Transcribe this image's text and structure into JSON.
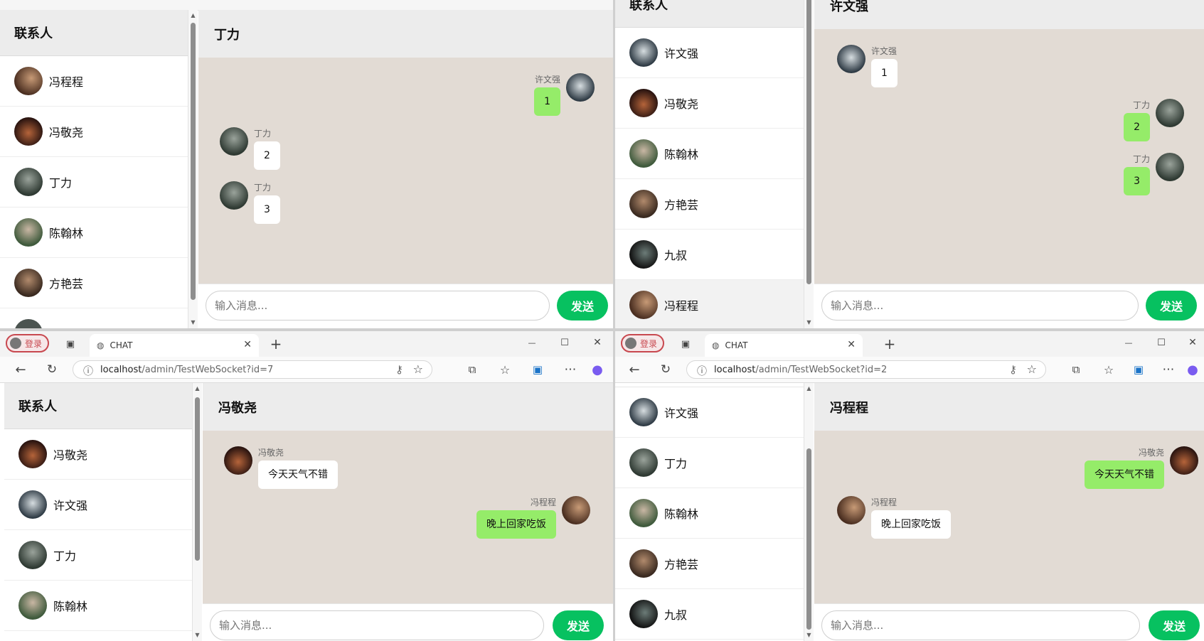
{
  "send_label": "发送",
  "input_placeholder": "输入消息...",
  "contacts_title": "联系人",
  "window_top_left": {
    "contacts": [
      "冯程程",
      "冯敬尧",
      "丁力",
      "陈翰林",
      "方艳芸"
    ],
    "chat_title": "丁力",
    "messages": [
      {
        "sender": "许文强",
        "text": "1",
        "side": "right"
      },
      {
        "sender": "丁力",
        "text": "2",
        "side": "left"
      },
      {
        "sender": "丁力",
        "text": "3",
        "side": "left"
      }
    ]
  },
  "window_top_right": {
    "contacts": [
      "许文强",
      "冯敬尧",
      "陈翰林",
      "方艳芸",
      "九叔",
      "冯程程"
    ],
    "chat_title": "许文强",
    "messages": [
      {
        "sender": "许文强",
        "text": "1",
        "side": "left"
      },
      {
        "sender": "丁力",
        "text": "2",
        "side": "right"
      },
      {
        "sender": "丁力",
        "text": "3",
        "side": "right"
      }
    ]
  },
  "window_bottom_left": {
    "tab_title": "CHAT",
    "profile_label": "登录",
    "url_host": "localhost",
    "url_path": "/admin/TestWebSocket?id=7",
    "contacts": [
      "冯敬尧",
      "许文强",
      "丁力",
      "陈翰林"
    ],
    "chat_title": "冯敬尧",
    "messages": [
      {
        "sender": "冯敬尧",
        "text": "今天天气不错",
        "side": "left"
      },
      {
        "sender": "冯程程",
        "text": "晚上回家吃饭",
        "side": "right"
      }
    ]
  },
  "window_bottom_right": {
    "tab_title": "CHAT",
    "profile_label": "登录",
    "url_host": "localhost",
    "url_path": "/admin/TestWebSocket?id=2",
    "contacts": [
      "许文强",
      "丁力",
      "陈翰林",
      "方艳芸",
      "九叔"
    ],
    "chat_title": "冯程程",
    "messages": [
      {
        "sender": "冯敬尧",
        "text": "今天天气不错",
        "side": "right"
      },
      {
        "sender": "冯程程",
        "text": "晚上回家吃饭",
        "side": "left"
      }
    ]
  },
  "icons": {
    "back": "←",
    "refresh": "↻",
    "info": "ⓘ",
    "key": "⚷",
    "star": "☆",
    "extensions": "⧉",
    "favorites": "☆",
    "collections": "▣",
    "more": "⋯",
    "copilot": "●",
    "new_tab": "+",
    "minimize": "—",
    "maximize": "☐",
    "close": "✕",
    "tabs": "▣",
    "globe": "🌐"
  },
  "colors": {
    "accent": "#07c160",
    "bubble_self": "#95ec69",
    "chat_bg": "#e2dbd4",
    "header_bg": "#ececec",
    "login": "#c8484f"
  }
}
